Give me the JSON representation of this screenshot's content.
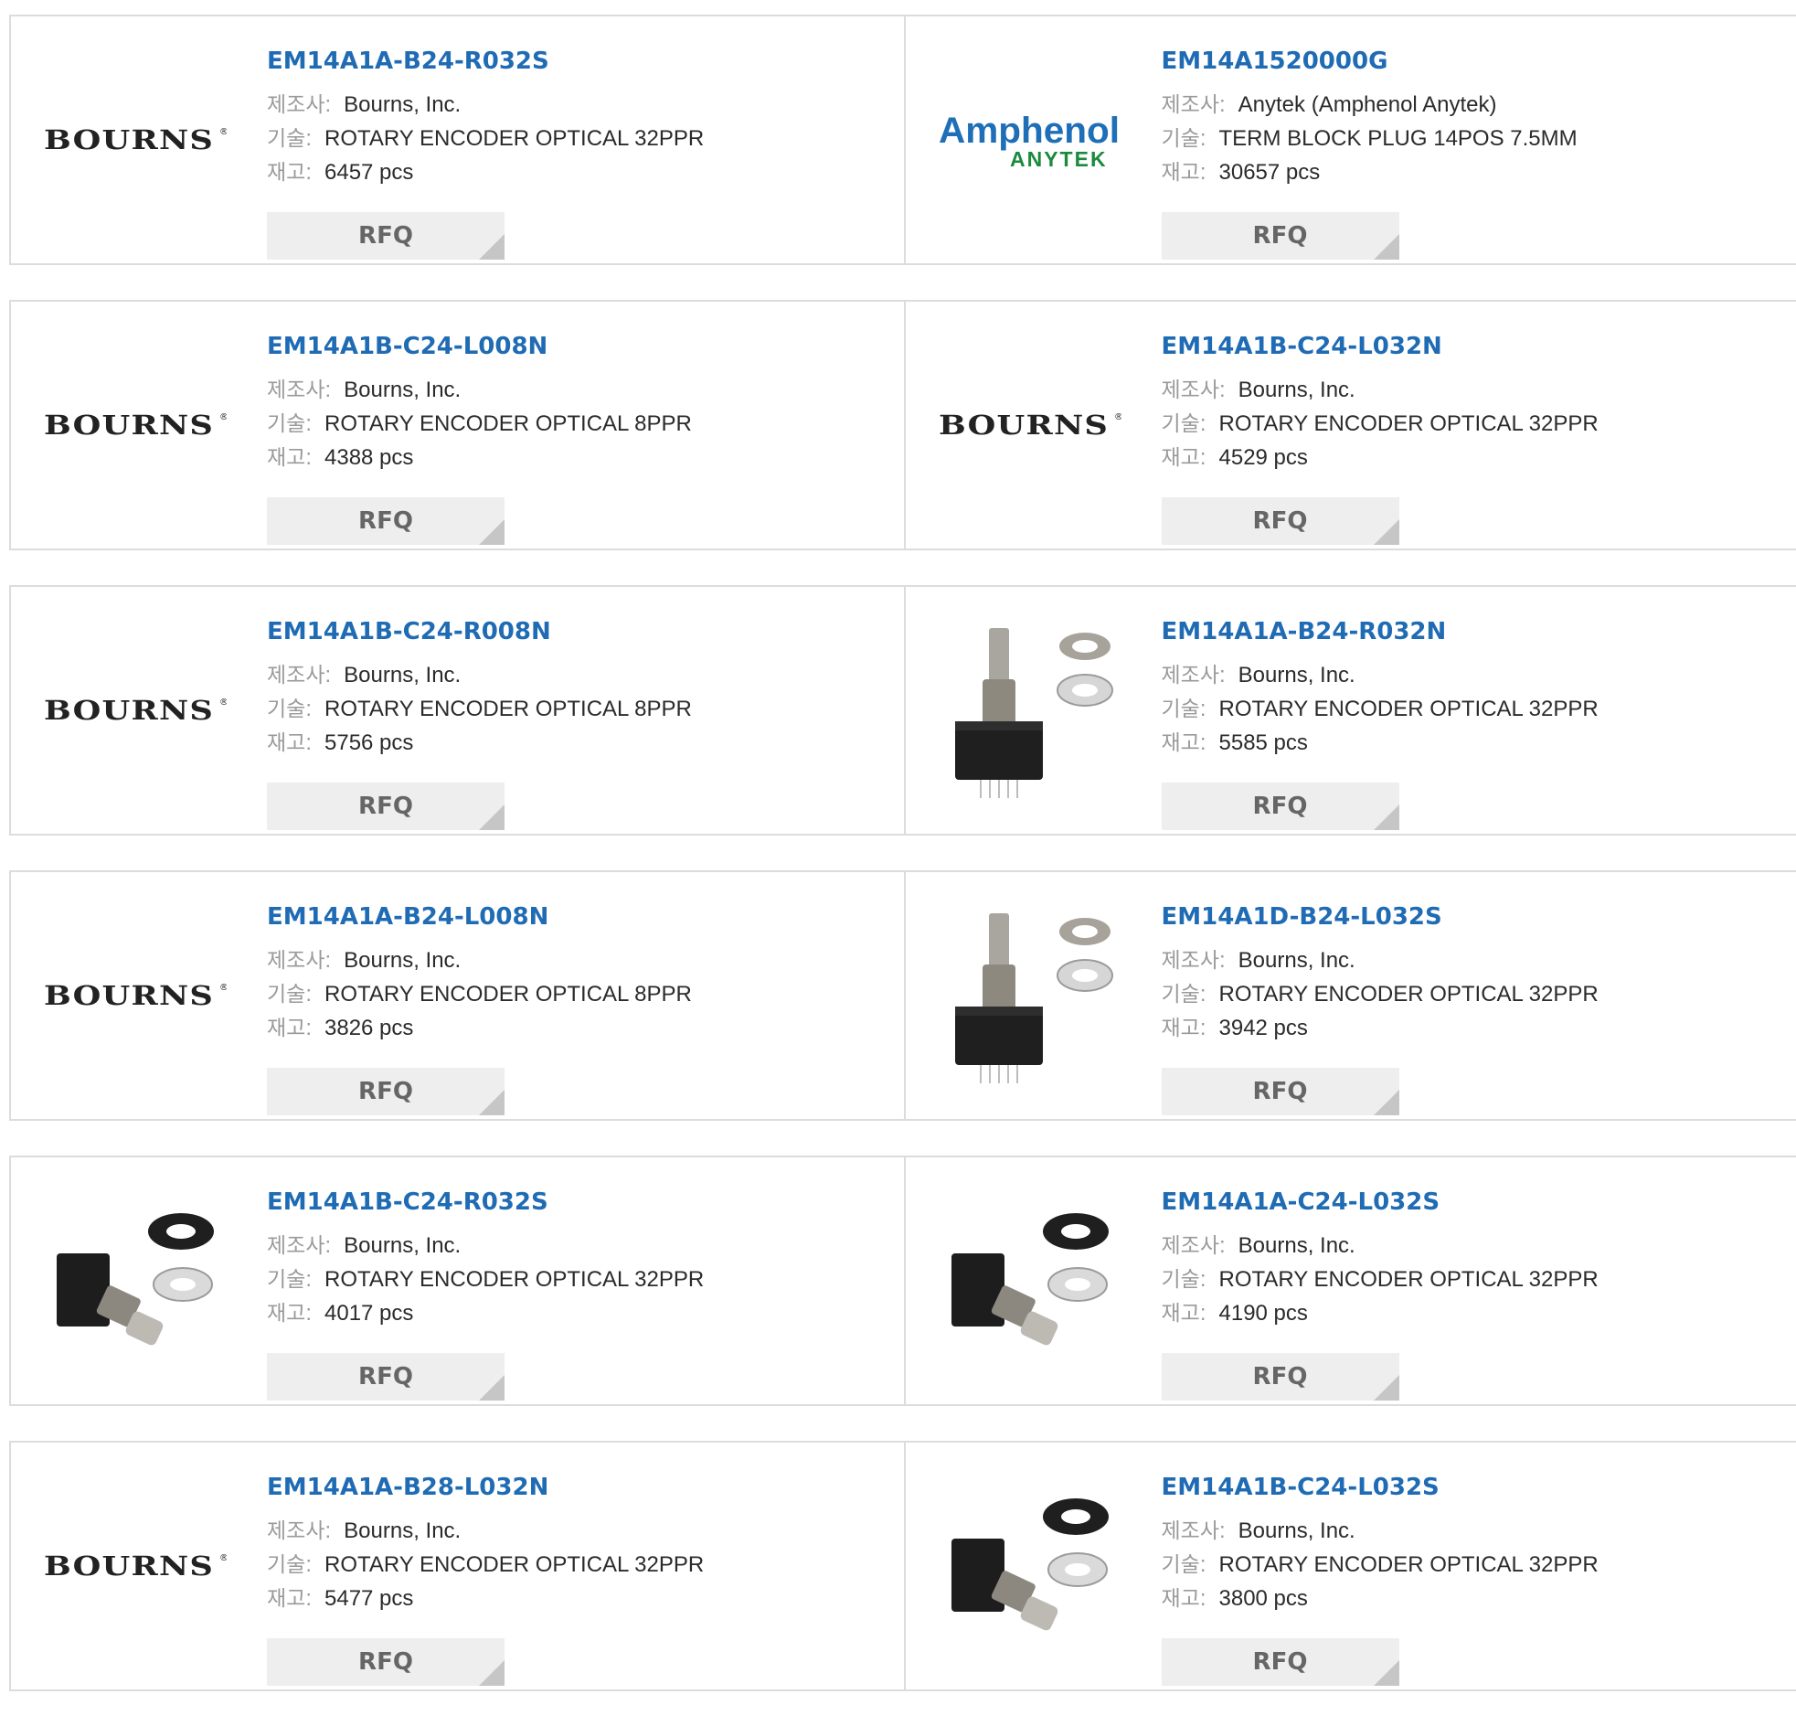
{
  "labels": {
    "manufacturer": "제조사",
    "description": "기술",
    "stock": "재고",
    "rfq": "RFQ"
  },
  "brand_logos": {
    "bourns": "BOURNS",
    "amphenol_top": "Amphenol",
    "amphenol_bottom": "ANYTEK"
  },
  "products": [
    {
      "part": "EM14A1A-B24-R032S",
      "manufacturer": "Bourns, Inc.",
      "description": "ROTARY ENCODER OPTICAL 32PPR",
      "stock": "6457 pcs",
      "image": "bourns-logo"
    },
    {
      "part": "EM14A1520000G",
      "manufacturer": "Anytek (Amphenol Anytek)",
      "description": "TERM BLOCK PLUG 14POS 7.5MM",
      "stock": "30657 pcs",
      "image": "amphenol-logo"
    },
    {
      "part": "EM14A1B-C24-L008N",
      "manufacturer": "Bourns, Inc.",
      "description": "ROTARY ENCODER OPTICAL 8PPR",
      "stock": "4388 pcs",
      "image": "bourns-logo"
    },
    {
      "part": "EM14A1B-C24-L032N",
      "manufacturer": "Bourns, Inc.",
      "description": "ROTARY ENCODER OPTICAL 32PPR",
      "stock": "4529 pcs",
      "image": "bourns-logo"
    },
    {
      "part": "EM14A1B-C24-R008N",
      "manufacturer": "Bourns, Inc.",
      "description": "ROTARY ENCODER OPTICAL 8PPR",
      "stock": "5756 pcs",
      "image": "bourns-logo"
    },
    {
      "part": "EM14A1A-B24-R032N",
      "manufacturer": "Bourns, Inc.",
      "description": "ROTARY ENCODER OPTICAL 32PPR",
      "stock": "5585 pcs",
      "image": "encoder-upright-photo"
    },
    {
      "part": "EM14A1A-B24-L008N",
      "manufacturer": "Bourns, Inc.",
      "description": "ROTARY ENCODER OPTICAL 8PPR",
      "stock": "3826 pcs",
      "image": "bourns-logo"
    },
    {
      "part": "EM14A1D-B24-L032S",
      "manufacturer": "Bourns, Inc.",
      "description": "ROTARY ENCODER OPTICAL 32PPR",
      "stock": "3942 pcs",
      "image": "encoder-upright-photo"
    },
    {
      "part": "EM14A1B-C24-R032S",
      "manufacturer": "Bourns, Inc.",
      "description": "ROTARY ENCODER OPTICAL 32PPR",
      "stock": "4017 pcs",
      "image": "encoder-side-photo"
    },
    {
      "part": "EM14A1A-C24-L032S",
      "manufacturer": "Bourns, Inc.",
      "description": "ROTARY ENCODER OPTICAL 32PPR",
      "stock": "4190 pcs",
      "image": "encoder-side-photo"
    },
    {
      "part": "EM14A1A-B28-L032N",
      "manufacturer": "Bourns, Inc.",
      "description": "ROTARY ENCODER OPTICAL 32PPR",
      "stock": "5477 pcs",
      "image": "bourns-logo"
    },
    {
      "part": "EM14A1B-C24-L032S",
      "manufacturer": "Bourns, Inc.",
      "description": "ROTARY ENCODER OPTICAL 32PPR",
      "stock": "3800 pcs",
      "image": "encoder-side-photo"
    }
  ],
  "colors": {
    "part_link": "#1f6bb4",
    "label_gray": "#9a9a9a",
    "rfq_bg": "#eeeeee",
    "border": "#dcdcdc"
  }
}
